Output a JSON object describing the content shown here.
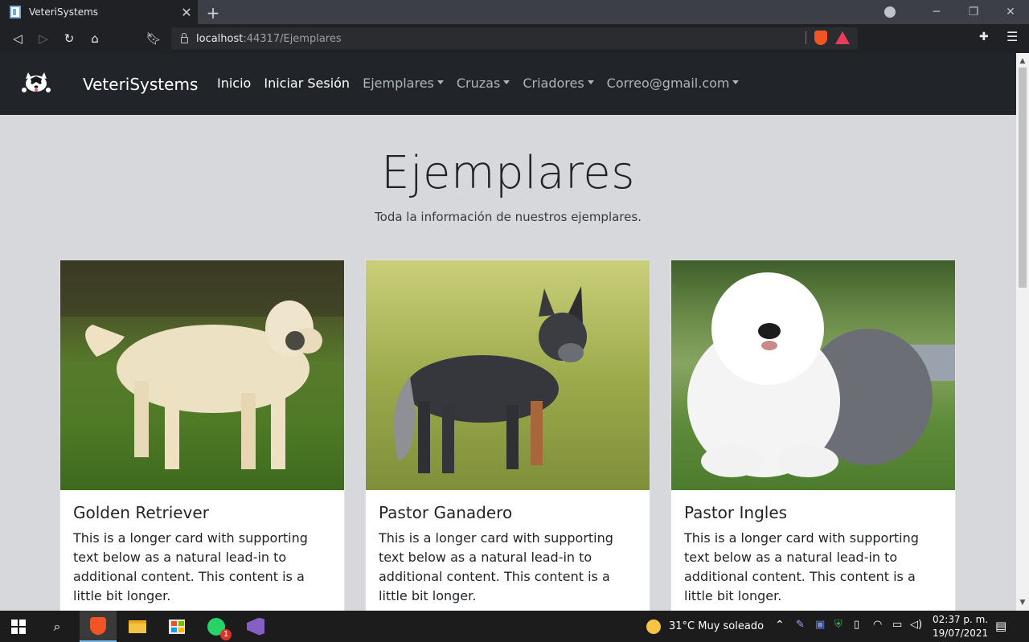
{
  "browser": {
    "tab_title": "VeteriSystems",
    "url_host": "localhost",
    "url_rest": ":44317/Ejemplares"
  },
  "nav": {
    "brand": "VeteriSystems",
    "links": [
      {
        "label": "Inicio"
      },
      {
        "label": "Iniciar Sesión"
      },
      {
        "label": "Ejemplares"
      },
      {
        "label": "Cruzas"
      },
      {
        "label": "Criadores"
      },
      {
        "label": "Correo@gmail.com"
      }
    ]
  },
  "page": {
    "title": "Ejemplares",
    "subtitle": "Toda la información de nuestros ejemplares."
  },
  "cards": [
    {
      "title": "Golden Retriever",
      "text": "This is a longer card with supporting text below as a natural lead-in to additional content. This content is a little bit longer."
    },
    {
      "title": "Pastor Ganadero",
      "text": "This is a longer card with supporting text below as a natural lead-in to additional content. This content is a little bit longer."
    },
    {
      "title": "Pastor Ingles",
      "text": "This is a longer card with supporting text below as a natural lead-in to additional content. This content is a little bit longer."
    }
  ],
  "taskbar": {
    "weather": "31°C  Muy soleado",
    "time": "02:37 p. m.",
    "date": "19/07/2021",
    "whatsapp_badge": "1"
  },
  "colors": {
    "navbar_bg": "#212529",
    "page_bg": "#d6d8dc"
  }
}
